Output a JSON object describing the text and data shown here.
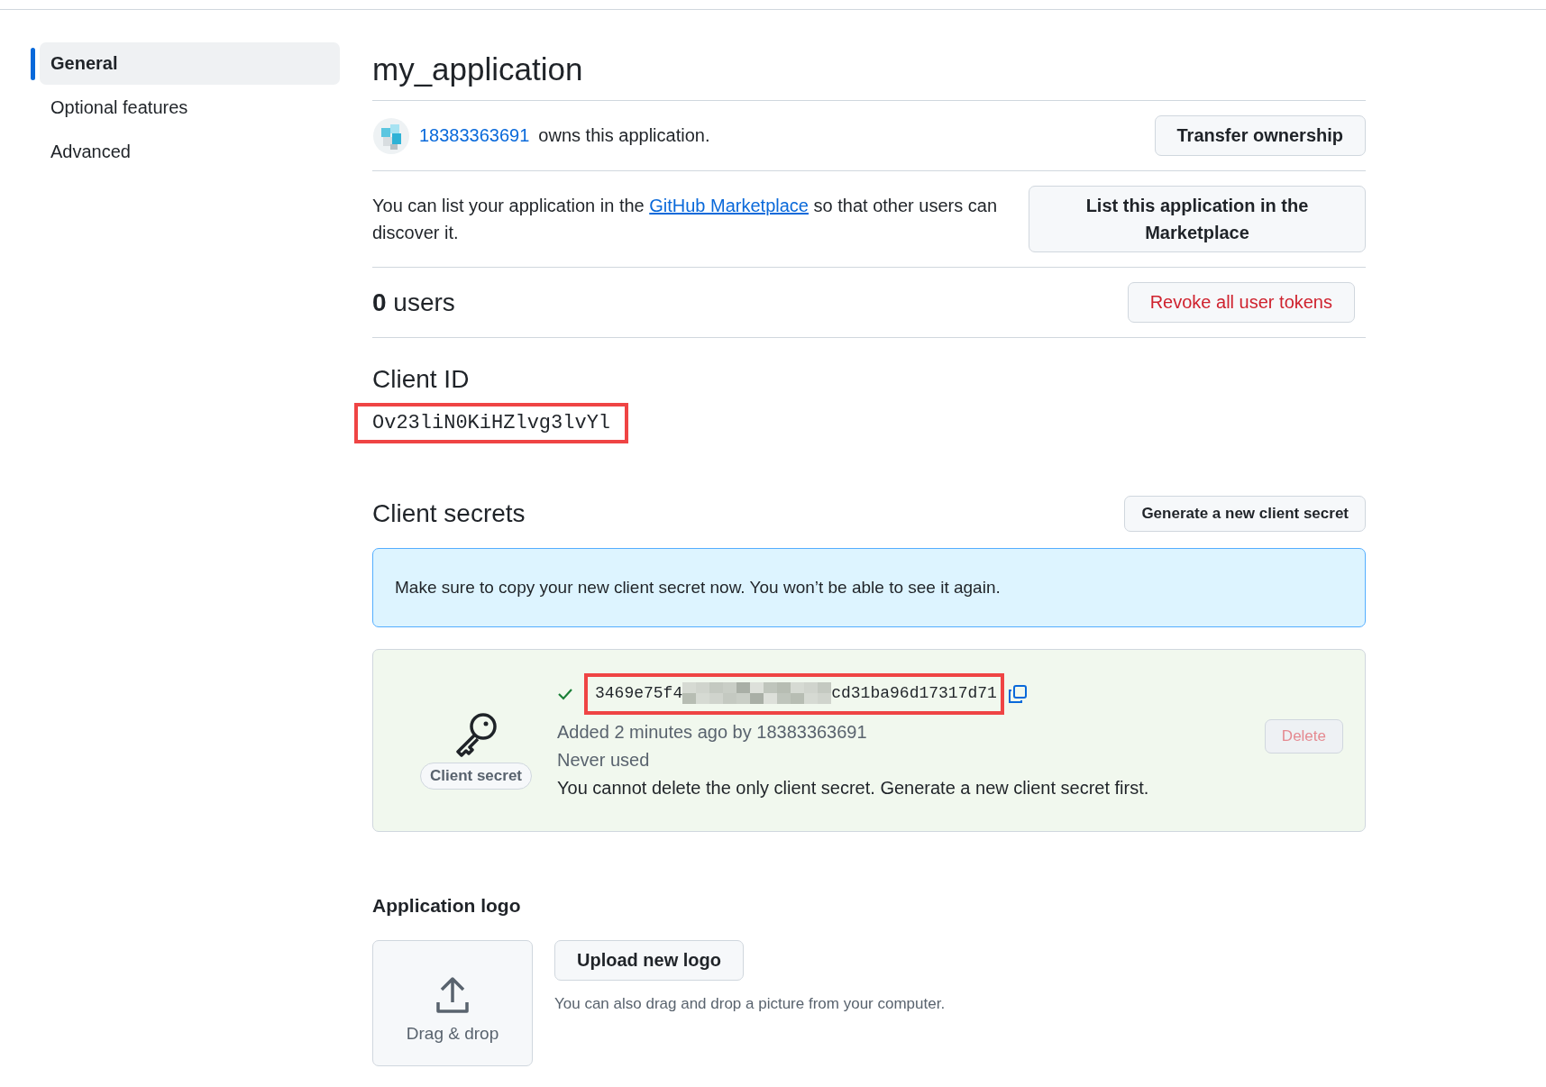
{
  "sidebar": {
    "items": [
      {
        "label": "General",
        "selected": true
      },
      {
        "label": "Optional features",
        "selected": false
      },
      {
        "label": "Advanced",
        "selected": false
      }
    ]
  },
  "app": {
    "title": "my_application",
    "owner": "18383363691",
    "owner_suffix": "owns this application.",
    "transfer_button": "Transfer ownership"
  },
  "marketplace": {
    "text_before": "You can list your application in the",
    "link": "GitHub Marketplace",
    "text_after": "so that other users can discover it.",
    "button": "List this application in the Marketplace"
  },
  "users": {
    "count": "0",
    "label": "users",
    "revoke_button": "Revoke all user tokens"
  },
  "client_id": {
    "heading": "Client ID",
    "value": "Ov23liN0KiHZlvg3lvYl",
    "highlighted": true
  },
  "client_secrets": {
    "heading": "Client secrets",
    "generate_button": "Generate a new client secret",
    "notice": "Make sure to copy your new client secret now. You won’t be able to see it again.",
    "secrets": [
      {
        "badge": "Client secret",
        "value_start": "3469e75f4",
        "value_end": "cd31ba96d17317d71",
        "redacted": true,
        "highlighted": true,
        "added": "Added 2 minutes ago by 18383363691",
        "usage": "Never used",
        "warning": "You cannot delete the only client secret. Generate a new client secret first.",
        "delete_button": "Delete",
        "delete_disabled": true
      }
    ]
  },
  "logo": {
    "heading": "Application logo",
    "drop_label": "Drag & drop",
    "upload_button": "Upload new logo",
    "hint": "You can also drag and drop a picture from your computer."
  }
}
